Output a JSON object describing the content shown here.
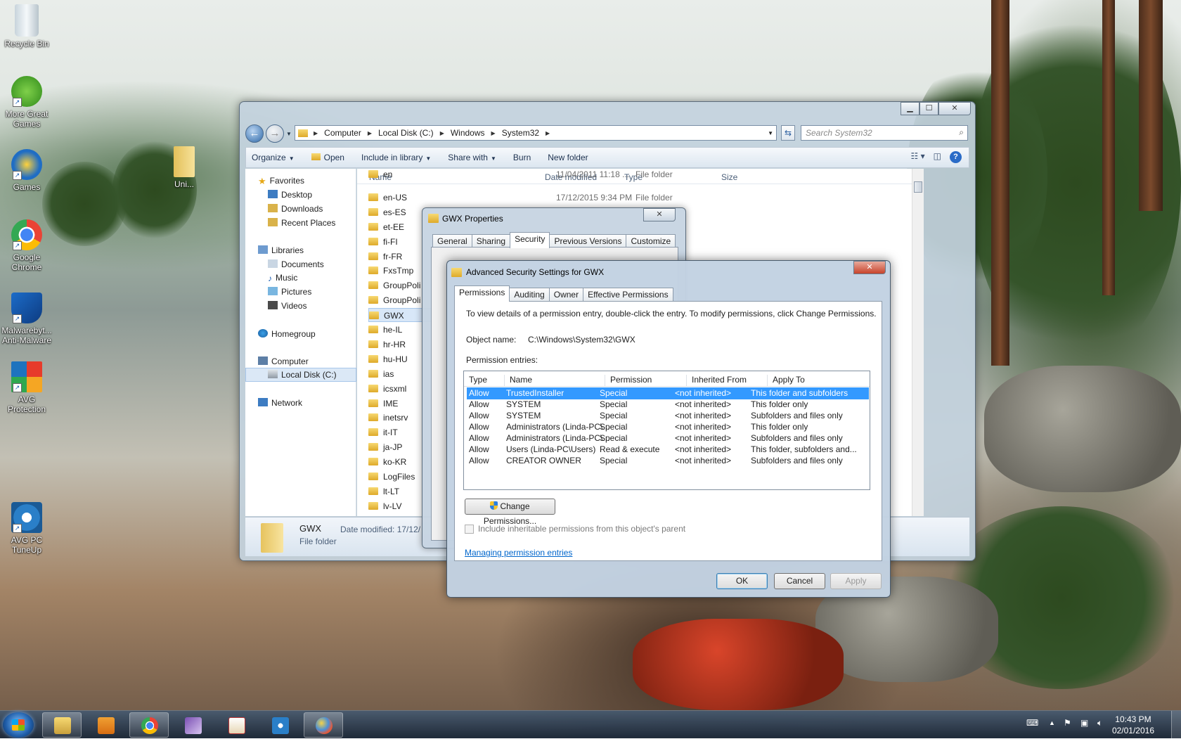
{
  "desktop": {
    "icons": [
      {
        "label": "Recycle Bin",
        "icon": "recycle-bin-icon"
      },
      {
        "label": "More Great Games",
        "icon": "games-icon"
      },
      {
        "label": "Games",
        "icon": "big-fish-games-icon"
      },
      {
        "label": "Google Chrome",
        "icon": "chrome-icon"
      },
      {
        "label": "Malwarebyt... Anti-Malware",
        "icon": "malwarebytes-icon"
      },
      {
        "label": "AVG Protection",
        "icon": "avg-icon"
      },
      {
        "label": "AVG PC TuneUp",
        "icon": "tuneup-icon"
      },
      {
        "label": "Uni...",
        "icon": "file-icon"
      }
    ]
  },
  "explorer": {
    "address": [
      "Computer",
      "Local Disk (C:)",
      "Windows",
      "System32"
    ],
    "search_placeholder": "Search System32",
    "toolbar": [
      "Organize",
      "Open",
      "Include in library",
      "Share with",
      "Burn",
      "New folder"
    ],
    "nav": {
      "favorites": "Favorites",
      "favorites_items": [
        "Desktop",
        "Downloads",
        "Recent Places"
      ],
      "libraries": "Libraries",
      "libraries_items": [
        "Documents",
        "Music",
        "Pictures",
        "Videos"
      ],
      "homegroup": "Homegroup",
      "computer": "Computer",
      "computer_items": [
        "Local Disk (C:)"
      ],
      "network": "Network"
    },
    "columns": {
      "name": "Name",
      "date": "Date modified",
      "type": "Type",
      "size": "Size"
    },
    "files": [
      {
        "name": "en",
        "date": "11/04/2011 11:18 ...",
        "type": "File folder"
      },
      {
        "name": "en-US",
        "date": "17/12/2015 9:34 PM",
        "type": "File folder"
      },
      {
        "name": "es-ES",
        "date": "",
        "type": ""
      },
      {
        "name": "et-EE",
        "date": "",
        "type": ""
      },
      {
        "name": "fi-FI",
        "date": "",
        "type": ""
      },
      {
        "name": "fr-FR",
        "date": "",
        "type": ""
      },
      {
        "name": "FxsTmp",
        "date": "",
        "type": ""
      },
      {
        "name": "GroupPoli",
        "date": "",
        "type": ""
      },
      {
        "name": "GroupPoli",
        "date": "",
        "type": ""
      },
      {
        "name": "GWX",
        "date": "",
        "type": ""
      },
      {
        "name": "he-IL",
        "date": "",
        "type": ""
      },
      {
        "name": "hr-HR",
        "date": "",
        "type": ""
      },
      {
        "name": "hu-HU",
        "date": "",
        "type": ""
      },
      {
        "name": "ias",
        "date": "",
        "type": ""
      },
      {
        "name": "icsxml",
        "date": "",
        "type": ""
      },
      {
        "name": "IME",
        "date": "",
        "type": ""
      },
      {
        "name": "inetsrv",
        "date": "",
        "type": ""
      },
      {
        "name": "it-IT",
        "date": "",
        "type": ""
      },
      {
        "name": "ja-JP",
        "date": "",
        "type": ""
      },
      {
        "name": "ko-KR",
        "date": "",
        "type": ""
      },
      {
        "name": "LogFiles",
        "date": "",
        "type": ""
      },
      {
        "name": "lt-LT",
        "date": "",
        "type": ""
      },
      {
        "name": "lv-LV",
        "date": "",
        "type": ""
      }
    ],
    "details": {
      "name": "GWX",
      "type": "File folder",
      "date_label": "Date modified: 17/12/"
    }
  },
  "properties": {
    "title": "GWX Properties",
    "tabs": [
      "General",
      "Sharing",
      "Security",
      "Previous Versions",
      "Customize"
    ],
    "active_tab": "Security"
  },
  "advanced": {
    "title": "Advanced Security Settings for GWX",
    "tabs": [
      "Permissions",
      "Auditing",
      "Owner",
      "Effective Permissions"
    ],
    "active_tab": "Permissions",
    "intro": "To view details of a permission entry, double-click the entry. To modify permissions, click Change Permissions.",
    "object_label": "Object name:",
    "object_value": "C:\\Windows\\System32\\GWX",
    "entries_label": "Permission entries:",
    "columns": {
      "type": "Type",
      "name": "Name",
      "permission": "Permission",
      "inherited": "Inherited From",
      "apply": "Apply To"
    },
    "entries": [
      {
        "type": "Allow",
        "name": "TrustedInstaller",
        "permission": "Special",
        "inherited": "<not inherited>",
        "apply": "This folder and subfolders"
      },
      {
        "type": "Allow",
        "name": "SYSTEM",
        "permission": "Special",
        "inherited": "<not inherited>",
        "apply": "This folder only"
      },
      {
        "type": "Allow",
        "name": "SYSTEM",
        "permission": "Special",
        "inherited": "<not inherited>",
        "apply": "Subfolders and files only"
      },
      {
        "type": "Allow",
        "name": "Administrators (Linda-PC\\...",
        "permission": "Special",
        "inherited": "<not inherited>",
        "apply": "This folder only"
      },
      {
        "type": "Allow",
        "name": "Administrators (Linda-PC\\...",
        "permission": "Special",
        "inherited": "<not inherited>",
        "apply": "Subfolders and files only"
      },
      {
        "type": "Allow",
        "name": "Users (Linda-PC\\Users)",
        "permission": "Read & execute",
        "inherited": "<not inherited>",
        "apply": "This folder, subfolders and..."
      },
      {
        "type": "Allow",
        "name": "CREATOR OWNER",
        "permission": "Special",
        "inherited": "<not inherited>",
        "apply": "Subfolders and files only"
      }
    ],
    "change_button": "Change Permissions...",
    "inherit_checkbox": "Include inheritable permissions from this object's parent",
    "link": "Managing permission entries",
    "ok": "OK",
    "cancel": "Cancel",
    "apply": "Apply"
  },
  "taskbar": {
    "time": "10:43 PM",
    "date": "02/01/2016",
    "items": [
      "explorer-icon",
      "media-player-icon",
      "chrome-icon",
      "winrar-icon",
      "solitaire-icon",
      "tuneup-icon",
      "paint-icon"
    ]
  }
}
